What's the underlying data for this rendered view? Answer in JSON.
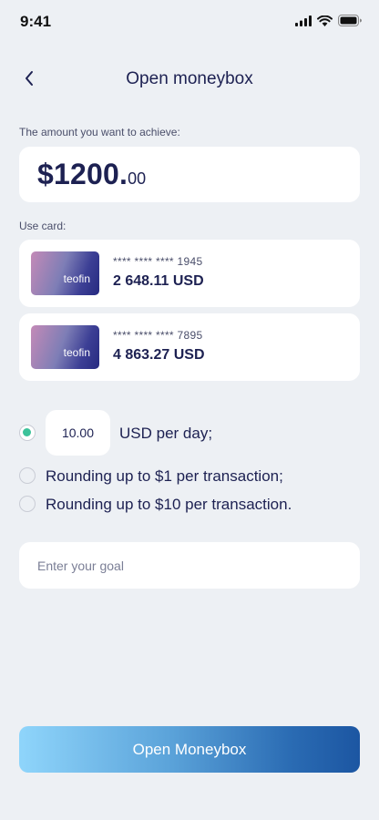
{
  "status_bar": {
    "time": "9:41",
    "icons": [
      "signal-icon",
      "wifi-icon",
      "battery-icon"
    ]
  },
  "header": {
    "title": "Open moneybox",
    "back_icon": "chevron-left-icon"
  },
  "amount": {
    "label": "The amount you want to achieve:",
    "main": "$1200.",
    "cents": "00"
  },
  "cards": {
    "label": "Use card:",
    "items": [
      {
        "brand": "teofin",
        "number": "**** **** **** 1945",
        "balance": "2 648.11 USD"
      },
      {
        "brand": "teofin",
        "number": "**** **** **** 7895",
        "balance": "4 863.27 USD"
      }
    ]
  },
  "options": {
    "per_day_value": "10.00",
    "per_day_label": "USD per day;",
    "round1_label": "Rounding up to $1 per transaction;",
    "round10_label": "Rounding up to $10 per transaction.",
    "selected": "per_day"
  },
  "goal": {
    "placeholder": "Enter your goal"
  },
  "submit": {
    "label": "Open Moneybox"
  },
  "colors": {
    "background": "#edf0f4",
    "text_primary": "#1d2152",
    "radio_selected": "#3cc29a",
    "button_gradient_start": "#8fd5fb",
    "button_gradient_end": "#1c56a2"
  }
}
